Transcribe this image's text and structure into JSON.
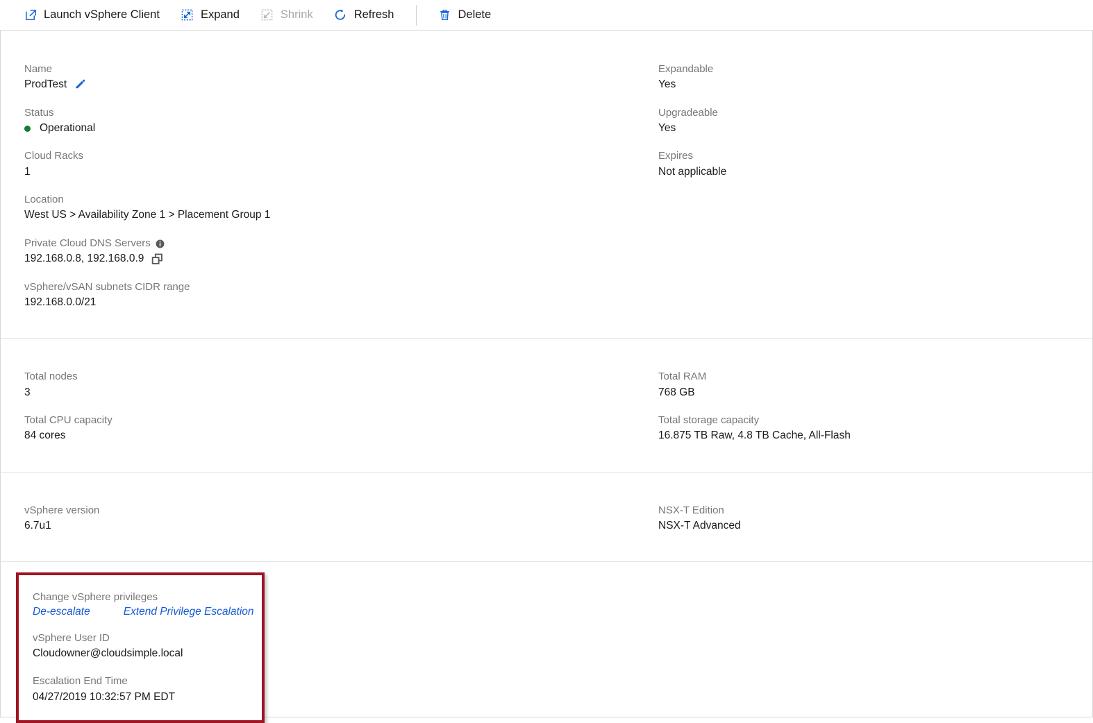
{
  "toolbar": {
    "items": [
      {
        "label": "Launch vSphere Client",
        "icon": "external-link-icon",
        "disabled": false
      },
      {
        "label": "Expand",
        "icon": "expand-icon",
        "disabled": false
      },
      {
        "label": "Shrink",
        "icon": "shrink-icon",
        "disabled": true
      },
      {
        "label": "Refresh",
        "icon": "refresh-icon",
        "disabled": false
      },
      {
        "label": "Delete",
        "icon": "trash-icon",
        "disabled": false
      }
    ]
  },
  "overview": {
    "left": {
      "name_label": "Name",
      "name_value": "ProdTest",
      "status_label": "Status",
      "status_value": "Operational",
      "status_color": "#127f2f",
      "cloud_racks_label": "Cloud Racks",
      "cloud_racks_value": "1",
      "location_label": "Location",
      "location_value": "West US > Availability Zone 1 > Placement Group 1",
      "dns_label": "Private Cloud DNS Servers",
      "dns_value": "192.168.0.8, 192.168.0.9",
      "cidr_label": "vSphere/vSAN subnets CIDR range",
      "cidr_value": "192.168.0.0/21"
    },
    "right": {
      "expandable_label": "Expandable",
      "expandable_value": "Yes",
      "upgradeable_label": "Upgradeable",
      "upgradeable_value": "Yes",
      "expires_label": "Expires",
      "expires_value": "Not applicable"
    }
  },
  "capacity": {
    "left": {
      "total_nodes_label": "Total nodes",
      "total_nodes_value": "3",
      "total_cpu_label": "Total CPU capacity",
      "total_cpu_value": "84 cores"
    },
    "right": {
      "total_ram_label": "Total RAM",
      "total_ram_value": "768 GB",
      "total_storage_label": "Total storage capacity",
      "total_storage_value": "16.875 TB Raw, 4.8 TB Cache, All-Flash"
    }
  },
  "versions": {
    "left": {
      "vsphere_version_label": "vSphere version",
      "vsphere_version_value": "6.7u1"
    },
    "right": {
      "nsxt_edition_label": "NSX-T Edition",
      "nsxt_edition_value": "NSX-T Advanced"
    }
  },
  "privileges": {
    "change_label": "Change vSphere privileges",
    "deescalate_link": "De-escalate",
    "extend_link": "Extend Privilege Escalation",
    "user_id_label": "vSphere User ID",
    "user_id_value": "Cloudowner@cloudsimple.local",
    "end_time_label": "Escalation End Time",
    "end_time_value": "04/27/2019 10:32:57 PM EDT",
    "highlight_color": "#9e1523"
  }
}
